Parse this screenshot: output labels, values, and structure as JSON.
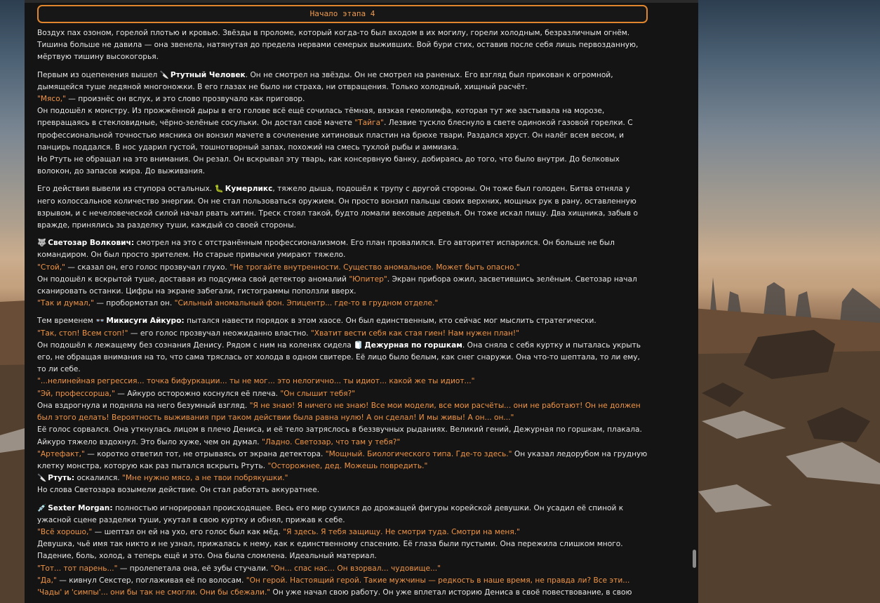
{
  "banner": "Начало этапа 4",
  "p1": "Воздух пах озоном, горелой плотью и кровью. Звёзды в проломе, который когда-то был входом в их могилу, горели холодным, безразличным огнём. Тишина больше не давила — она звенела, натянутая до предела нервами семерых выживших. Вой бури стих, оставив после себя лишь первозданную, мёртвую тишину высокогорья.",
  "p2": {
    "a": "Первым из оцепенения вышел",
    "icon": "🔪",
    "name": "Ртутный Человек",
    "b": ". Он не смотрел на звёзды. Он не смотрел на раненых. Его взгляд был прикован к огромной, дымящейся туше ледяной многоножки. В его глазах не было ни страха, ни отвращения. Только холодный, хищный расчёт.",
    "q1": "\"Мясо,\"",
    "c": " — произнёс он вслух, и это слово прозвучало как приговор.",
    "d": "Он подошёл к монстру. Из прожжённой дыры в его голове всё ещё сочилась тёмная, вязкая гемолимфа, которая тут же застывала на морозе, превращаясь в стекловидные, чёрно-зелёные сосульки. Он достал своё мачете ",
    "q2": "\"Тайга\"",
    "e": ". Лезвие тускло блеснуло в свете одинокой газовой горелки. С профессиональной точностью мясника он вонзил мачете в сочленение хитиновых пластин на брюхе твари. Раздался хруст. Он налёг всем весом, и панцирь поддался. В нос ударил густой, тошнотворный запах, похожий на смесь тухлой рыбы и аммиака.",
    "f": "Но Ртуть не обращал на это внимания. Он резал. Он вскрывал эту тварь, как консервную банку, добираясь до того, что было внутри. До белковых волокон, до запасов жира. До выживания."
  },
  "p3": {
    "a": "Его действия вывели из ступора остальных.",
    "icon": "🐛",
    "name": "Кумерликс",
    "b": ", тяжело дыша, подошёл к трупу с другой стороны. Он тоже был голоден. Битва отняла у него колоссальное количество энергии. Он не стал пользоваться оружием. Он просто вонзил пальцы своих верхних, мощных рук в рану, оставленную взрывом, и с нечеловеческой силой начал рвать хитин. Треск стоял такой, будто ломали вековые деревья. Он тоже искал пищу. Два хищника, забыв о вражде, принялись за разделку туши, каждый со своей стороны."
  },
  "p4": {
    "icon": "🐺",
    "name": "Светозар Волкович:",
    "a": " смотрел на это с отстранённым профессионализмом. Его план провалился. Его авторитет испарился. Он больше не был командиром. Он был просто зрителем. Но старые привычки умирают тяжело.",
    "q1": "\"Стой,\"",
    "b": " — сказал он, его голос прозвучал глухо. ",
    "q2": "\"Не трогайте внутренности. Существо аномальное. Может быть опасно.\"",
    "c": "Он подошёл к вскрытой туше, доставая из подсумка свой детектор аномалий ",
    "q3": "\"Юпитер\"",
    "d": ". Экран прибора ожил, засветившись зелёным. Светозар начал сканировать останки. Цифры на экране забегали, гистограммы поползли вверх.",
    "q4": "\"Так и думал,\"",
    "e": " — пробормотал он. ",
    "q5": "\"Сильный аномальный фон. Эпицентр... где-то в грудном отделе.\""
  },
  "p5": {
    "a": "Тем временем ",
    "icon1": "👓",
    "name1": "Микисуги Айкуро:",
    "b": " пытался навести порядок в этом хаосе. Он был единственным, кто сейчас мог мыслить стратегически.",
    "q1": "\"Так, стоп! Всем стоп!\"",
    "c": " — его голос прозвучал неожиданно властно. ",
    "q2": "\"Хватит вести себя как стая гиен! Нам нужен план!\"",
    "d": "Он подошёл к лежащему без сознания Денису. Рядом с ним на коленях сидела ",
    "icon2": "🧻",
    "name2": "Дежурная по горшкам",
    "e": ". Она сняла с себя куртку и пыталась укрыть его, не обращая внимания на то, что сама тряслась от холода в одном свитере. Её лицо было белым, как снег снаружи. Она что-то шептала, то ли ему, то ли себе.",
    "q3": "\"...нелинейная регрессия... точка бифуркации... ты не мог... это нелогично... ты идиот... какой же ты идиот...\"",
    "q4": "\"Эй, профессорша,\"",
    "f": " — Айкуро осторожно коснулся её плеча. ",
    "q5": "\"Он слышит тебя?\"",
    "g": "Она вздрогнула и подняла на него безумный взгляд. ",
    "q6": "\"Я не знаю! Я ничего не знаю! Все мои модели, все мои расчёты... они не работают! Он не должен был этого делать! Вероятность выживания при таком действии была равна нулю! А он сделал! И мы живы! А он... он...\"",
    "h": "Её голос сорвался. Она уткнулась лицом в плечо Дениса, и её тело затряслось в беззвучных рыданиях. Великий гений, Дежурная по горшкам, плакала.",
    "i": "Айкуро тяжело вздохнул. Это было хуже, чем он думал. ",
    "q7": "\"Ладно. Светозар, что там у тебя?\"",
    "q8": "\"Артефакт,\"",
    "j": " — коротко ответил тот, не отрываясь от экрана детектора. ",
    "q9": "\"Мощный. Биологического типа. Где-то здесь.\"",
    "k": " Он указал ледорубом на грудную клетку монстра, которую как раз пытался вскрыть Ртуть. ",
    "q10": "\"Осторожнее, дед. Можешь повредить.\"",
    "icon3": "🔪",
    "name3": "Ртуть:",
    "l": " оскалился. ",
    "q11": "\"Мне нужно мясо, а не твои побрякушки.\"",
    "m": "Но слова Светозара возымели действие. Он стал работать аккуратнее."
  },
  "p6": {
    "icon": "💉",
    "name": "Sexter Morgan:",
    "a": " полностью игнорировал происходящее. Весь его мир сузился до дрожащей фигуры корейской девушки. Он усадил её спиной к ужасной сцене разделки туши, укутал в свою куртку и обнял, прижав к себе.",
    "q1": "\"Всё хорошо,\"",
    "b": " — шептал он ей на ухо, его голос был как мёд. ",
    "q2": "\"Я здесь. Я тебя защищу. Не смотри туда. Смотри на меня.\"",
    "c": "Девушка, чьё имя так никто и не узнал, прижалась к нему, как к единственному спасению. Её глаза были пустыми. Она пережила слишком много. Падение, боль, холод, а теперь ещё и это. Она была сломлена. Идеальный материал.",
    "q3": "\"Тот... тот парень...\"",
    "d": " — пролепетала она, её зубы стучали. ",
    "q4": "\"Он... спас нас... Он взорвал... чудовище...\"",
    "q5": "\"Да,\"",
    "e": " — кивнул Секстер, поглаживая её по волосам. ",
    "q6": "\"Он герой. Настоящий герой. Такие мужчины — редкость в наше время, не правда ли? Все эти... 'Чады' и 'симпы'... они бы так не смогли. Они бы сбежали.\"",
    "f": " Он уже начал свою работу. Он уже вплетал историю Дениса в своё повествование, в свою"
  },
  "colors": {
    "accent": "#f19546",
    "panel": "#141414",
    "text": "#e6e6e6"
  }
}
